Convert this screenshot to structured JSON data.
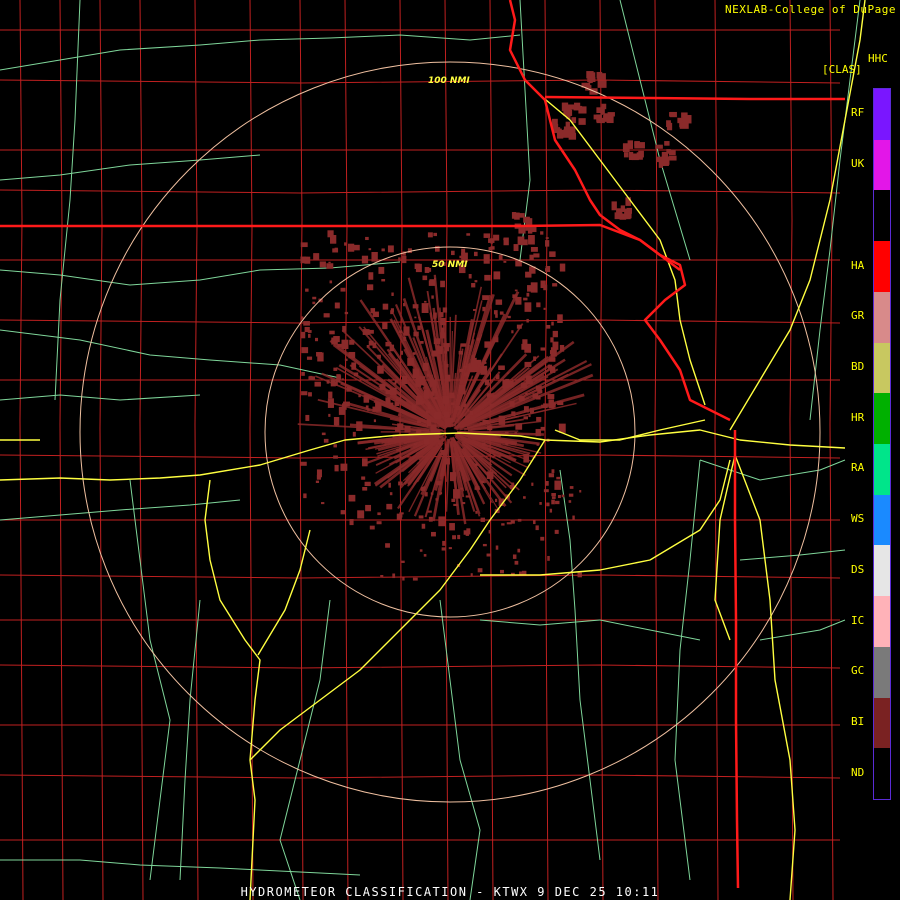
{
  "credit": "NEXLAB-College of DuPage",
  "product": {
    "code": "HHC",
    "mode": "[CLAS]"
  },
  "footer": "HYDROMETEOR CLASSIFICATION - KTWX 9 DEC 25 10:11",
  "range_rings": [
    {
      "label": "50 NMI",
      "nmi": 50
    },
    {
      "label": "100 NMI",
      "nmi": 100
    }
  ],
  "legend": [
    {
      "code": "RF",
      "color": "#7a16ff"
    },
    {
      "code": "UK",
      "color": "#e316e8"
    },
    {
      "code": "",
      "color": "#000000"
    },
    {
      "code": "HA",
      "color": "#ff0000"
    },
    {
      "code": "GR",
      "color": "#d88a8a"
    },
    {
      "code": "BD",
      "color": "#c8c860"
    },
    {
      "code": "HR",
      "color": "#00b000"
    },
    {
      "code": "RA",
      "color": "#00e58a"
    },
    {
      "code": "WS",
      "color": "#1a8aff"
    },
    {
      "code": "DS",
      "color": "#e6e6e6"
    },
    {
      "code": "IC",
      "color": "#ffb2b8"
    },
    {
      "code": "GC",
      "color": "#7a7a7a"
    },
    {
      "code": "BI",
      "color": "#7a2222"
    },
    {
      "code": "ND",
      "color": "#000000"
    }
  ],
  "colors": {
    "state_border": "#ff1a1a",
    "county_line": "#c02020",
    "road_minor": "#7fd69a",
    "highway": "#ffff40",
    "ring": "#f0c0a0",
    "echo": "#8a2a2a"
  }
}
